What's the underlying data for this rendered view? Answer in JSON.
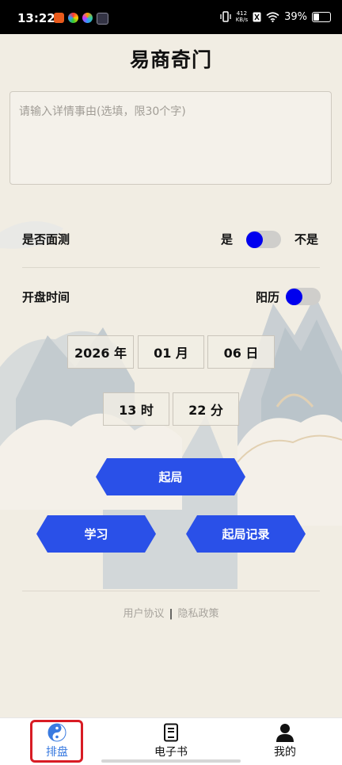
{
  "status_bar": {
    "time": "13:22",
    "net_speed_top": "412",
    "net_speed_unit": "KB/s",
    "battery": "39%",
    "battery_level": 0.39
  },
  "page_title": "易商奇门",
  "reason_input": {
    "placeholder": "请输入详情事由(选填，限30个字)",
    "value": ""
  },
  "in_person": {
    "label": "是否面测",
    "yes_label": "是",
    "no_label": "不是",
    "selected": "是"
  },
  "start_time": {
    "label": "开盘时间",
    "calendar_label": "阳历",
    "calendar_on": true,
    "year": "2026 年",
    "month": "01 月",
    "day": "06 日",
    "hour": "13 时",
    "minute": "22 分"
  },
  "buttons": {
    "start": "起局",
    "learn": "学习",
    "records": "起局记录"
  },
  "footer": {
    "user_agreement": "用户协议",
    "separator": "|",
    "privacy_policy": "隐私政策"
  },
  "tabbar": {
    "tabs": [
      {
        "label": "排盘",
        "icon": "yin-yang-icon",
        "active": true
      },
      {
        "label": "电子书",
        "icon": "book-icon",
        "active": false
      },
      {
        "label": "我的",
        "icon": "user-icon",
        "active": false
      }
    ]
  },
  "colors": {
    "accent_blue": "#2a50e8",
    "toggle_knob": "#0000ee",
    "active_tab": "#3a7be0",
    "highlight_red": "#d81c24"
  }
}
